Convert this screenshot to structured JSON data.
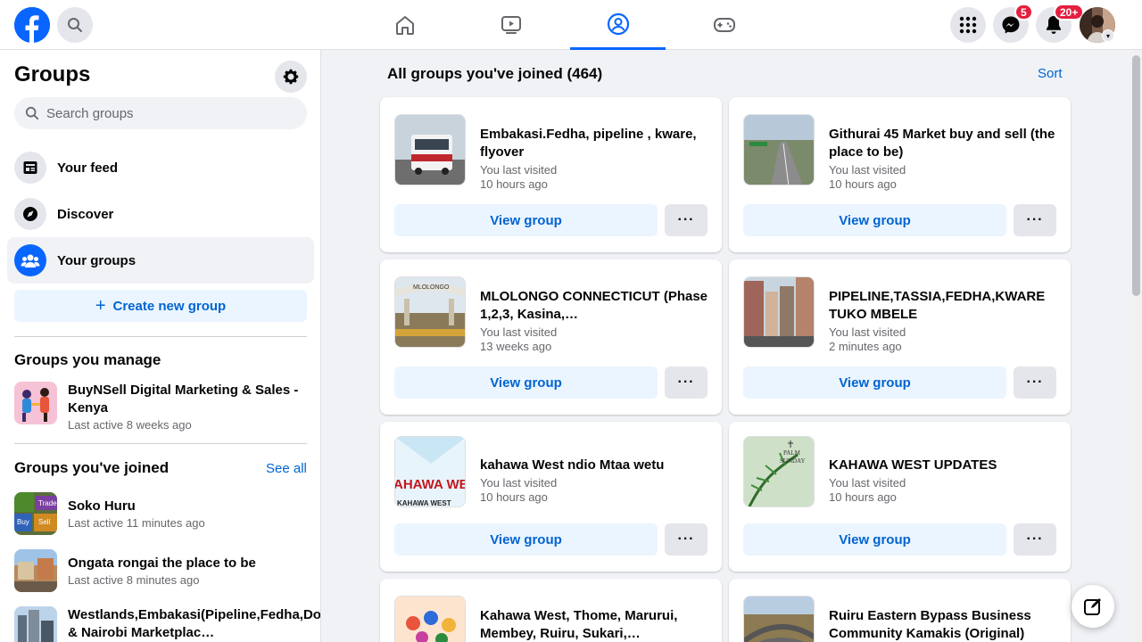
{
  "nav": {
    "badges": {
      "messenger": "5",
      "notifications": "20+"
    }
  },
  "sidebar": {
    "title": "Groups",
    "search_placeholder": "Search groups",
    "items": [
      {
        "label": "Your feed",
        "icon": "feed-icon"
      },
      {
        "label": "Discover",
        "icon": "compass-icon"
      },
      {
        "label": "Your groups",
        "icon": "groups-icon"
      }
    ],
    "create_label": "Create new group",
    "manage_title": "Groups you manage",
    "managed": [
      {
        "name": "BuyNSell Digital Marketing & Sales - Kenya",
        "sub": "Last active 8 weeks ago"
      }
    ],
    "joined_title": "Groups you've joined",
    "see_all": "See all",
    "joined": [
      {
        "name": "Soko Huru",
        "sub": "Last active 11 minutes ago"
      },
      {
        "name": "Ongata rongai the place to be",
        "sub": "Last active 8 minutes ago"
      },
      {
        "name": "Westlands,Embakasi(Pipeline,Fedha,Donholm) & Nairobi Marketplac…",
        "sub": ""
      }
    ]
  },
  "main": {
    "header": "All groups you've joined (464)",
    "sort": "Sort",
    "view_label": "View group",
    "more_label": "···",
    "cards": [
      {
        "name": "Embakasi.Fedha, pipeline , kware, flyover",
        "sub1": "You last visited",
        "sub2": "10 hours ago"
      },
      {
        "name": "Githurai 45 Market buy and sell (the place to be)",
        "sub1": "You last visited",
        "sub2": "10 hours ago"
      },
      {
        "name": "MLOLONGO CONNECTICUT (Phase 1,2,3, Kasina,…",
        "sub1": "You last visited",
        "sub2": "13 weeks ago"
      },
      {
        "name": "PIPELINE,TASSIA,FEDHA,KWARE TUKO MBELE",
        "sub1": "You last visited",
        "sub2": "2 minutes ago"
      },
      {
        "name": "kahawa West ndio Mtaa wetu",
        "sub1": "You last visited",
        "sub2": "10 hours ago"
      },
      {
        "name": "KAHAWA WEST UPDATES",
        "sub1": "You last visited",
        "sub2": "10 hours ago"
      },
      {
        "name": "Kahawa West, Thome, Marurui, Membey, Ruiru, Sukari,…",
        "sub1": "",
        "sub2": ""
      },
      {
        "name": "Ruiru Eastern Bypass Business Community Kamakis (Original)",
        "sub1": "",
        "sub2": ""
      }
    ],
    "thumb_text": {
      "mlolongo": "MLOLONGO",
      "kahawa_big": "AHAWA WES",
      "kahawa_small": "KAHAWA WEST",
      "palm": "PALM",
      "sunday": "SUNDAY",
      "soko_trade": "Trade",
      "soko_buy": "Buy",
      "soko_sell": "Sell"
    }
  },
  "colors": {
    "accent": "#0866ff",
    "link": "#0064d1",
    "badge": "#e41e3f"
  }
}
